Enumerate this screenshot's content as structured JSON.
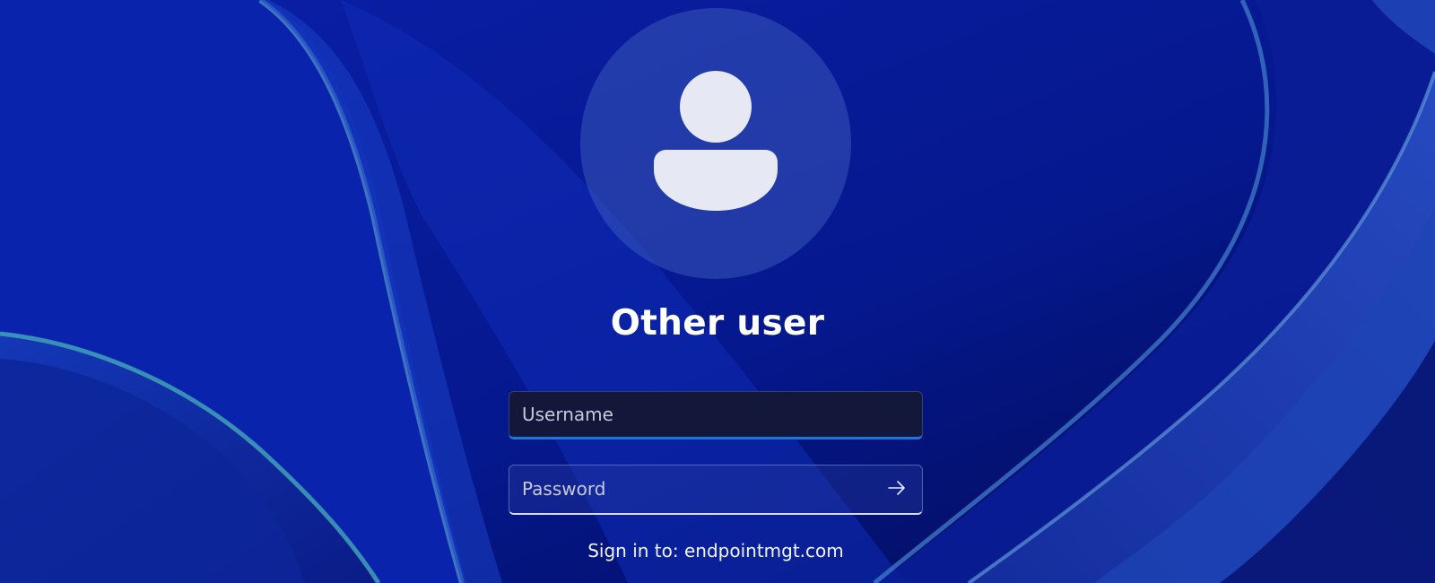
{
  "login": {
    "user_name": "Other user",
    "username": {
      "placeholder": "Username",
      "value": ""
    },
    "password": {
      "placeholder": "Password",
      "value": ""
    },
    "sign_in_label": "Sign in to: ",
    "domain": "endpointmgt.com"
  },
  "icons": {
    "avatar": "person-icon",
    "submit": "arrow-right-icon"
  },
  "colors": {
    "background": "#061a92",
    "focus_accent": "#1f73d9",
    "username_field_bg": "#13173a",
    "avatar_glyph": "#e6e9f4"
  }
}
